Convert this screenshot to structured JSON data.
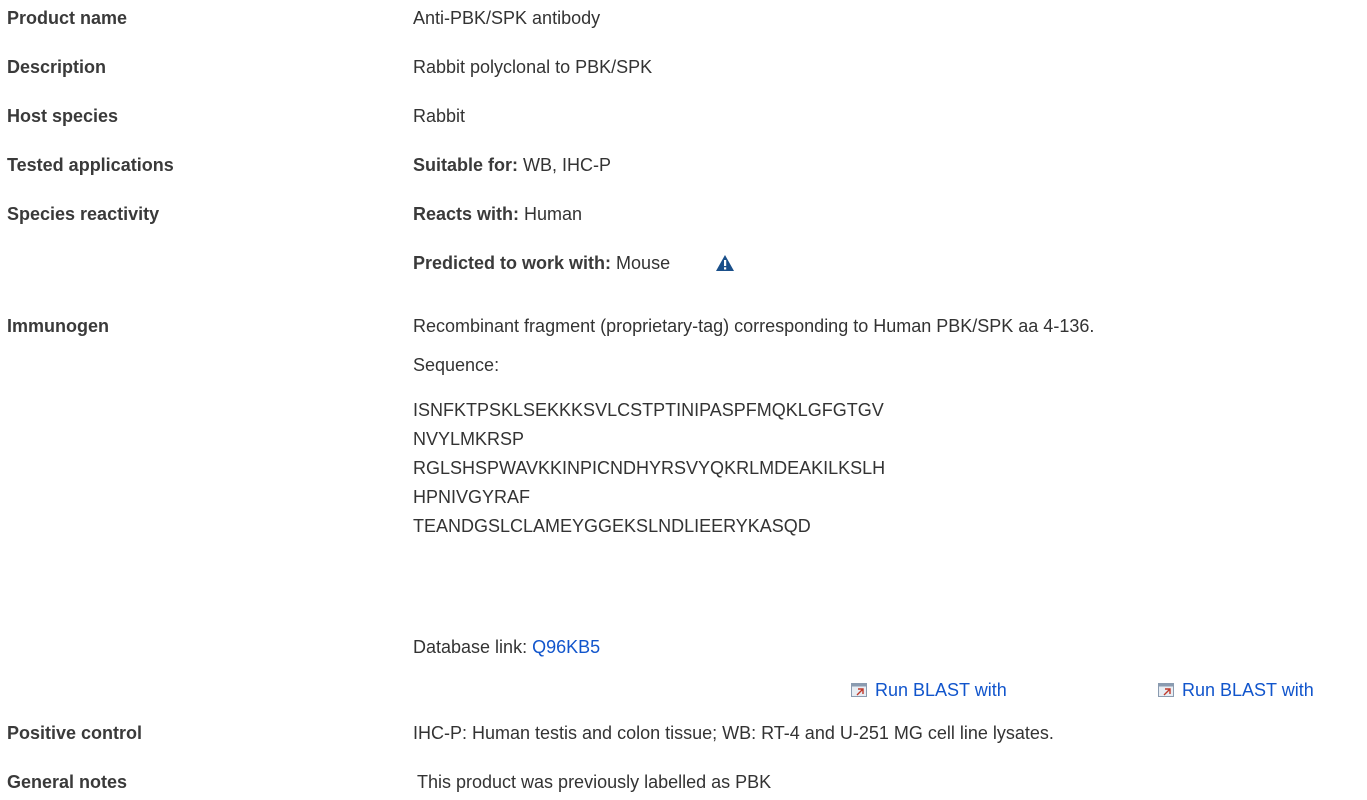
{
  "rows": {
    "product_name": {
      "label": "Product name",
      "value": "Anti-PBK/SPK antibody"
    },
    "description": {
      "label": "Description",
      "value": "Rabbit polyclonal to PBK/SPK"
    },
    "host_species": {
      "label": "Host species",
      "value": "Rabbit"
    },
    "tested_applications": {
      "label": "Tested applications",
      "prefix": "Suitable for:",
      "value": "WB, IHC-P"
    },
    "species_reactivity": {
      "label": "Species reactivity",
      "reacts_prefix": "Reacts with:",
      "reacts_value": "Human",
      "predicted_prefix": "Predicted to work with:",
      "predicted_value": "Mouse",
      "warning_icon": "warning-triangle-icon"
    },
    "immunogen": {
      "label": "Immunogen",
      "value": "Recombinant fragment (proprietary-tag) corresponding to Human PBK/SPK aa 4-136.",
      "sequence_label": "Sequence:",
      "sequence_lines": [
        "ISNFKTPSKLSEKKKSVLCSTPTINIPASPFMQKLGFGTGV",
        "NVYLMKRSP",
        "RGLSHSPWAVKKINPICNDHYRSVYQKRLMDEAKILKSLH",
        "HPNIVGYRAF",
        "TEANDGSLCLAMEYGGEKSLNDLIEERYKASQD"
      ],
      "database_prefix": "Database link:",
      "database_link": "Q96KB5",
      "blast_links": [
        "Run BLAST with",
        "Run BLAST with"
      ],
      "blast_icon": "external-window-icon"
    },
    "positive_control": {
      "label": "Positive control",
      "value": "IHC-P: Human testis and colon tissue; WB: RT-4 and U-251 MG cell line lysates."
    },
    "general_notes": {
      "label": "General notes",
      "value": "This product was previously labelled as PBK"
    }
  },
  "colors": {
    "link": "#1155cc",
    "warning": "#1a4f8a",
    "text": "#333333"
  }
}
